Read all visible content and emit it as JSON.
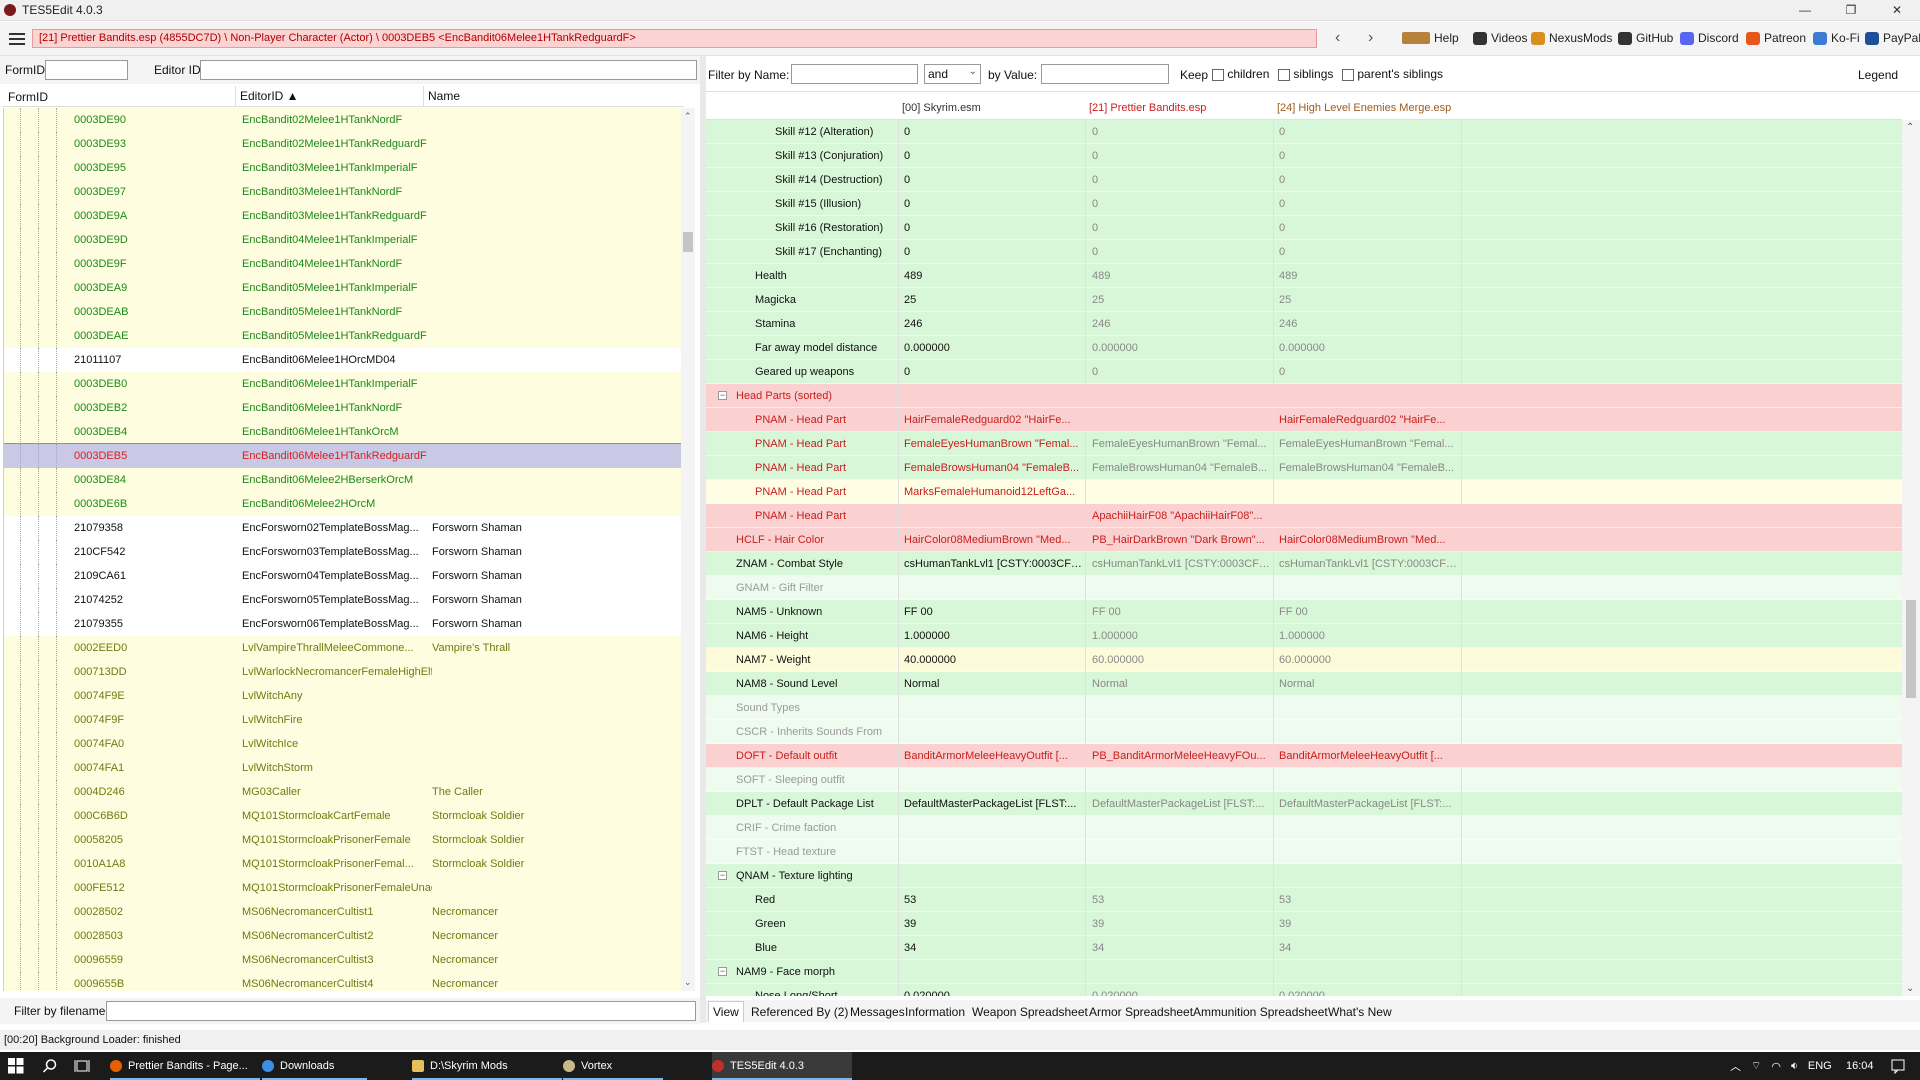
{
  "window": {
    "title": "TES5Edit 4.0.3",
    "controls": [
      "—",
      "❐",
      "✕"
    ]
  },
  "toolbar": {
    "path": "[21] Prettier Bandits.esp (4855DC7D) \\ Non-Player Character (Actor) \\ 0003DEB5 <EncBandit06Melee1HTankRedguardF>",
    "back": "‹",
    "forward": "›",
    "links": [
      {
        "label": "Help",
        "icon": "book-icon",
        "color": "#b7813b"
      },
      {
        "label": "Videos",
        "icon": "video-icon",
        "color": "#333333"
      },
      {
        "label": "NexusMods",
        "icon": "nexus-icon",
        "color": "#d98f20"
      },
      {
        "label": "GitHub",
        "icon": "github-icon",
        "color": "#333333"
      },
      {
        "label": "Discord",
        "icon": "discord-icon",
        "color": "#5865f2"
      },
      {
        "label": "Patreon",
        "icon": "patreon-icon",
        "color": "#e8571a"
      },
      {
        "label": "Ko-Fi",
        "icon": "kofi-icon",
        "color": "#3a7bd5"
      },
      {
        "label": "PayPal",
        "icon": "paypal-icon",
        "color": "#1e4f9a"
      }
    ]
  },
  "left": {
    "formid_label": "FormID",
    "editorid_label": "Editor ID",
    "formid_value": "",
    "editorid_value": "",
    "columns": [
      "FormID",
      "EditorID ▲",
      "Name"
    ],
    "rows": [
      {
        "formid": "0003DE90",
        "editorid": "EncBandit02Melee1HTankNordF",
        "name": "",
        "style": "green"
      },
      {
        "formid": "0003DE93",
        "editorid": "EncBandit02Melee1HTankRedguardF",
        "name": "",
        "style": "green"
      },
      {
        "formid": "0003DE95",
        "editorid": "EncBandit03Melee1HTankImperialF",
        "name": "",
        "style": "green"
      },
      {
        "formid": "0003DE97",
        "editorid": "EncBandit03Melee1HTankNordF",
        "name": "",
        "style": "green"
      },
      {
        "formid": "0003DE9A",
        "editorid": "EncBandit03Melee1HTankRedguardF",
        "name": "",
        "style": "green"
      },
      {
        "formid": "0003DE9D",
        "editorid": "EncBandit04Melee1HTankImperialF",
        "name": "",
        "style": "green"
      },
      {
        "formid": "0003DE9F",
        "editorid": "EncBandit04Melee1HTankNordF",
        "name": "",
        "style": "green"
      },
      {
        "formid": "0003DEA9",
        "editorid": "EncBandit05Melee1HTankImperialF",
        "name": "",
        "style": "green"
      },
      {
        "formid": "0003DEAB",
        "editorid": "EncBandit05Melee1HTankNordF",
        "name": "",
        "style": "green"
      },
      {
        "formid": "0003DEAE",
        "editorid": "EncBandit05Melee1HTankRedguardF",
        "name": "",
        "style": "green"
      },
      {
        "formid": "21011107",
        "editorid": "EncBandit06Melee1HOrcMD04",
        "name": "",
        "style": "black"
      },
      {
        "formid": "0003DEB0",
        "editorid": "EncBandit06Melee1HTankImperialF",
        "name": "",
        "style": "green"
      },
      {
        "formid": "0003DEB2",
        "editorid": "EncBandit06Melee1HTankNordF",
        "name": "",
        "style": "green"
      },
      {
        "formid": "0003DEB4",
        "editorid": "EncBandit06Melee1HTankOrcM",
        "name": "",
        "style": "green"
      },
      {
        "formid": "0003DEB5",
        "editorid": "EncBandit06Melee1HTankRedguardF",
        "name": "",
        "style": "selected"
      },
      {
        "formid": "0003DE84",
        "editorid": "EncBandit06Melee2HBerserkOrcM",
        "name": "",
        "style": "green"
      },
      {
        "formid": "0003DE6B",
        "editorid": "EncBandit06Melee2HOrcM",
        "name": "",
        "style": "green"
      },
      {
        "formid": "21079358",
        "editorid": "EncForsworn02TemplateBossMag...",
        "name": "Forsworn Shaman",
        "style": "black"
      },
      {
        "formid": "210CF542",
        "editorid": "EncForsworn03TemplateBossMag...",
        "name": "Forsworn Shaman",
        "style": "black"
      },
      {
        "formid": "2109CA61",
        "editorid": "EncForsworn04TemplateBossMag...",
        "name": "Forsworn Shaman",
        "style": "black"
      },
      {
        "formid": "21074252",
        "editorid": "EncForsworn05TemplateBossMag...",
        "name": "Forsworn Shaman",
        "style": "black"
      },
      {
        "formid": "21079355",
        "editorid": "EncForsworn06TemplateBossMag...",
        "name": "Forsworn Shaman",
        "style": "black"
      },
      {
        "formid": "0002EED0",
        "editorid": "LvlVampireThrallMeleeCommone...",
        "name": "Vampire's Thrall",
        "style": "olive"
      },
      {
        "formid": "000713DD",
        "editorid": "LvlWarlockNecromancerFemaleHighElf",
        "name": "",
        "style": "olive"
      },
      {
        "formid": "00074F9E",
        "editorid": "LvlWitchAny",
        "name": "",
        "style": "olive"
      },
      {
        "formid": "00074F9F",
        "editorid": "LvlWitchFire",
        "name": "",
        "style": "olive"
      },
      {
        "formid": "00074FA0",
        "editorid": "LvlWitchIce",
        "name": "",
        "style": "olive"
      },
      {
        "formid": "00074FA1",
        "editorid": "LvlWitchStorm",
        "name": "",
        "style": "olive"
      },
      {
        "formid": "0004D246",
        "editorid": "MG03Caller",
        "name": "The Caller",
        "style": "olive"
      },
      {
        "formid": "000C6B6D",
        "editorid": "MQ101StormcloakCartFemale",
        "name": "Stormcloak Soldier",
        "style": "olive"
      },
      {
        "formid": "00058205",
        "editorid": "MQ101StormcloakPrisonerFemale",
        "name": "Stormcloak Soldier",
        "style": "olive"
      },
      {
        "formid": "0010A1A8",
        "editorid": "MQ101StormcloakPrisonerFemal...",
        "name": "Stormcloak Soldier",
        "style": "olive"
      },
      {
        "formid": "000FE512",
        "editorid": "MQ101StormcloakPrisonerFemaleUnaggressive",
        "name": "",
        "style": "olive"
      },
      {
        "formid": "00028502",
        "editorid": "MS06NecromancerCultist1",
        "name": "Necromancer",
        "style": "olive"
      },
      {
        "formid": "00028503",
        "editorid": "MS06NecromancerCultist2",
        "name": "Necromancer",
        "style": "olive"
      },
      {
        "formid": "00096559",
        "editorid": "MS06NecromancerCultist3",
        "name": "Necromancer",
        "style": "olive"
      },
      {
        "formid": "0009655B",
        "editorid": "MS06NecromancerCultist4",
        "name": "Necromancer",
        "style": "olive"
      }
    ],
    "filter_label": "Filter by filename:",
    "filter_value": ""
  },
  "right": {
    "filter_name_label": "Filter by Name:",
    "filter_name_value": "",
    "logic_value": "and",
    "by_value_label": "by Value:",
    "by_value_value": "",
    "keep_label": "Keep",
    "children_label": "children",
    "siblings_label": "siblings",
    "parents_siblings_label": "parent's siblings",
    "legend_label": "Legend",
    "columns": [
      "[00] Skyrim.esm",
      "[21] Prettier Bandits.esp",
      "[24] High Level Enemies Merge.esp"
    ],
    "rows": [
      {
        "label": "Skill #12 (Alteration)",
        "indent": 2,
        "bg": "green",
        "color": "black",
        "v": [
          "0",
          "0",
          "0"
        ]
      },
      {
        "label": "Skill #13 (Conjuration)",
        "indent": 2,
        "bg": "green",
        "color": "black",
        "v": [
          "0",
          "0",
          "0"
        ]
      },
      {
        "label": "Skill #14 (Destruction)",
        "indent": 2,
        "bg": "green",
        "color": "black",
        "v": [
          "0",
          "0",
          "0"
        ]
      },
      {
        "label": "Skill #15 (Illusion)",
        "indent": 2,
        "bg": "green",
        "color": "black",
        "v": [
          "0",
          "0",
          "0"
        ]
      },
      {
        "label": "Skill #16 (Restoration)",
        "indent": 2,
        "bg": "green",
        "color": "black",
        "v": [
          "0",
          "0",
          "0"
        ]
      },
      {
        "label": "Skill #17 (Enchanting)",
        "indent": 2,
        "bg": "green",
        "color": "black",
        "v": [
          "0",
          "0",
          "0"
        ]
      },
      {
        "label": "Health",
        "indent": 1,
        "bg": "green",
        "color": "black",
        "v": [
          "489",
          "489",
          "489"
        ]
      },
      {
        "label": "Magicka",
        "indent": 1,
        "bg": "green",
        "color": "black",
        "v": [
          "25",
          "25",
          "25"
        ]
      },
      {
        "label": "Stamina",
        "indent": 1,
        "bg": "green",
        "color": "black",
        "v": [
          "246",
          "246",
          "246"
        ]
      },
      {
        "label": "Far away model distance",
        "indent": 1,
        "bg": "green",
        "color": "black",
        "v": [
          "0.000000",
          "0.000000",
          "0.000000"
        ]
      },
      {
        "label": "Geared up weapons",
        "indent": 1,
        "bg": "green",
        "color": "black",
        "v": [
          "0",
          "0",
          "0"
        ]
      },
      {
        "label": "Head Parts (sorted)",
        "indent": 0,
        "bg": "red",
        "color": "red",
        "v": [
          "",
          "",
          ""
        ],
        "toggle": "−"
      },
      {
        "label": "PNAM - Head Part",
        "indent": 1,
        "bg": "red",
        "color": "red",
        "v": [
          "HairFemaleRedguard02 \"HairFe...",
          "",
          "HairFemaleRedguard02 \"HairFe..."
        ]
      },
      {
        "label": "PNAM - Head Part",
        "indent": 1,
        "bg": "green",
        "color": "red",
        "v": [
          "FemaleEyesHumanBrown \"Femal...",
          "FemaleEyesHumanBrown \"Femal...",
          "FemaleEyesHumanBrown \"Femal..."
        ]
      },
      {
        "label": "PNAM - Head Part",
        "indent": 1,
        "bg": "green",
        "color": "red",
        "v": [
          "FemaleBrowsHuman04 \"FemaleB...",
          "FemaleBrowsHuman04 \"FemaleB...",
          "FemaleBrowsHuman04 \"FemaleB..."
        ]
      },
      {
        "label": "PNAM - Head Part",
        "indent": 1,
        "bg": "lyellow",
        "color": "red",
        "v": [
          "MarksFemaleHumanoid12LeftGa...",
          "",
          ""
        ]
      },
      {
        "label": "PNAM - Head Part",
        "indent": 1,
        "bg": "red",
        "color": "red",
        "v": [
          "",
          "ApachiiHairF08 \"ApachiiHairF08\"...",
          ""
        ]
      },
      {
        "label": "HCLF - Hair Color",
        "indent": 0,
        "bg": "red",
        "color": "red",
        "v": [
          "HairColor08MediumBrown \"Med...",
          "PB_HairDarkBrown \"Dark Brown\"...",
          "HairColor08MediumBrown \"Med..."
        ]
      },
      {
        "label": "ZNAM - Combat Style",
        "indent": 0,
        "bg": "green",
        "color": "black",
        "v": [
          "csHumanTankLvl1 [CSTY:0003CF5...",
          "csHumanTankLvl1 [CSTY:0003CF5...",
          "csHumanTankLvl1 [CSTY:0003CF5..."
        ]
      },
      {
        "label": "GNAM - Gift Filter",
        "indent": 0,
        "bg": "lgreen",
        "color": "faded",
        "v": [
          "",
          "",
          ""
        ]
      },
      {
        "label": "NAM5 - Unknown",
        "indent": 0,
        "bg": "green",
        "color": "black",
        "v": [
          "FF 00",
          "FF 00",
          "FF 00"
        ]
      },
      {
        "label": "NAM6 - Height",
        "indent": 0,
        "bg": "green",
        "color": "black",
        "v": [
          "1.000000",
          "1.000000",
          "1.000000"
        ]
      },
      {
        "label": "NAM7 - Weight",
        "indent": 0,
        "bg": "yellow",
        "color": "black",
        "v": [
          "40.000000",
          "60.000000",
          "60.000000"
        ]
      },
      {
        "label": "NAM8 - Sound Level",
        "indent": 0,
        "bg": "green",
        "color": "black",
        "v": [
          "Normal",
          "Normal",
          "Normal"
        ]
      },
      {
        "label": "Sound Types",
        "indent": 0,
        "bg": "lgreen",
        "color": "faded",
        "v": [
          "",
          "",
          ""
        ]
      },
      {
        "label": "CSCR - Inherits Sounds From",
        "indent": 0,
        "bg": "lgreen",
        "color": "faded",
        "v": [
          "",
          "",
          ""
        ]
      },
      {
        "label": "DOFT - Default outfit",
        "indent": 0,
        "bg": "red",
        "color": "red",
        "v": [
          "BanditArmorMeleeHeavyOutfit [...",
          "PB_BanditArmorMeleeHeavyFOu...",
          "BanditArmorMeleeHeavyOutfit [..."
        ]
      },
      {
        "label": "SOFT - Sleeping outfit",
        "indent": 0,
        "bg": "lgreen",
        "color": "faded",
        "v": [
          "",
          "",
          ""
        ]
      },
      {
        "label": "DPLT - Default Package List",
        "indent": 0,
        "bg": "green",
        "color": "black",
        "v": [
          "DefaultMasterPackageList [FLST:...",
          "DefaultMasterPackageList [FLST:...",
          "DefaultMasterPackageList [FLST:..."
        ]
      },
      {
        "label": "CRIF - Crime faction",
        "indent": 0,
        "bg": "lgreen",
        "color": "faded",
        "v": [
          "",
          "",
          ""
        ]
      },
      {
        "label": "FTST - Head texture",
        "indent": 0,
        "bg": "lgreen",
        "color": "faded",
        "v": [
          "",
          "",
          ""
        ]
      },
      {
        "label": "QNAM - Texture lighting",
        "indent": 0,
        "bg": "green",
        "color": "black",
        "v": [
          "",
          "",
          ""
        ],
        "toggle": "−"
      },
      {
        "label": "Red",
        "indent": 1,
        "bg": "green",
        "color": "black",
        "v": [
          "53",
          "53",
          "53"
        ]
      },
      {
        "label": "Green",
        "indent": 1,
        "bg": "green",
        "color": "black",
        "v": [
          "39",
          "39",
          "39"
        ]
      },
      {
        "label": "Blue",
        "indent": 1,
        "bg": "green",
        "color": "black",
        "v": [
          "34",
          "34",
          "34"
        ]
      },
      {
        "label": "NAM9 - Face morph",
        "indent": 0,
        "bg": "green",
        "color": "black",
        "v": [
          "",
          "",
          ""
        ],
        "toggle": "−"
      },
      {
        "label": "Nose Long/Short",
        "indent": 1,
        "bg": "green",
        "color": "black",
        "v": [
          "0.020000",
          "0.020000",
          "0.020000"
        ]
      }
    ],
    "tabs": [
      "View",
      "Referenced By (2)",
      "Messages",
      "Information",
      "Weapon Spreadsheet",
      "Armor Spreadsheet",
      "Ammunition Spreadsheet",
      "What's New"
    ]
  },
  "status": "[00:20] Background Loader: finished",
  "taskbar": {
    "items": [
      {
        "label": "Prettier Bandits - Page...",
        "icon": "firefox-icon",
        "color": "#e66000"
      },
      {
        "label": "Downloads",
        "icon": "download-icon",
        "color": "#3d8ee6"
      },
      {
        "label": "D:\\Skyrim Mods",
        "icon": "folder-icon",
        "color": "#e8c05a"
      },
      {
        "label": "Vortex",
        "icon": "vortex-icon",
        "color": "#c9b98a"
      },
      {
        "label": "TES5Edit 4.0.3",
        "icon": "tes5edit-icon",
        "color": "#c0302a"
      }
    ],
    "lang": "ENG",
    "time": "16:04"
  },
  "colors": {
    "green_row": "#d8f7d8",
    "red_row": "#fbd0d0",
    "yellow_row": "#fdfbd9",
    "selection": "#c9c9e6"
  }
}
